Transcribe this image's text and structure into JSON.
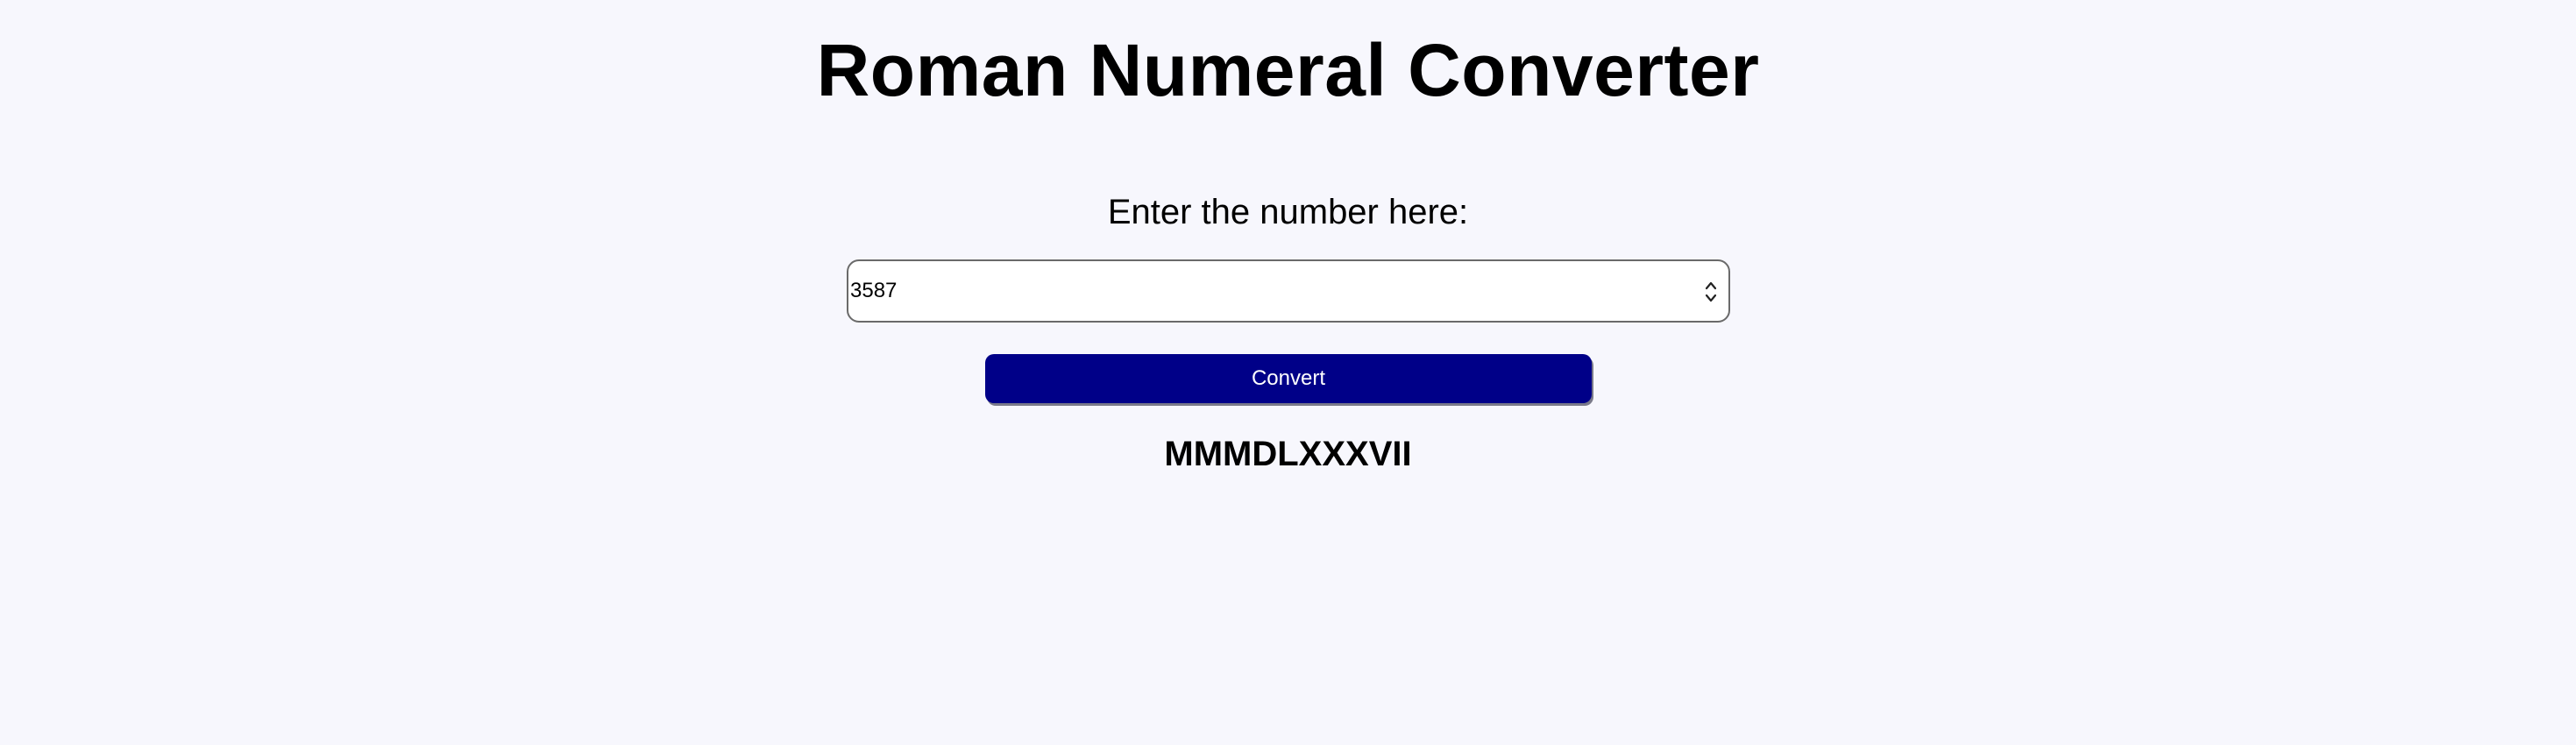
{
  "page": {
    "title": "Roman Numeral Converter",
    "background_color": "#f7f7fd"
  },
  "form": {
    "prompt_label": "Enter the number here:",
    "number_input": {
      "value": "3587",
      "placeholder": ""
    },
    "convert_button": {
      "label": "Convert",
      "color": "#000088"
    }
  },
  "result": {
    "text": "MMMDLXXXVII"
  },
  "icons": {
    "spinner": "number-spinner-icon"
  }
}
